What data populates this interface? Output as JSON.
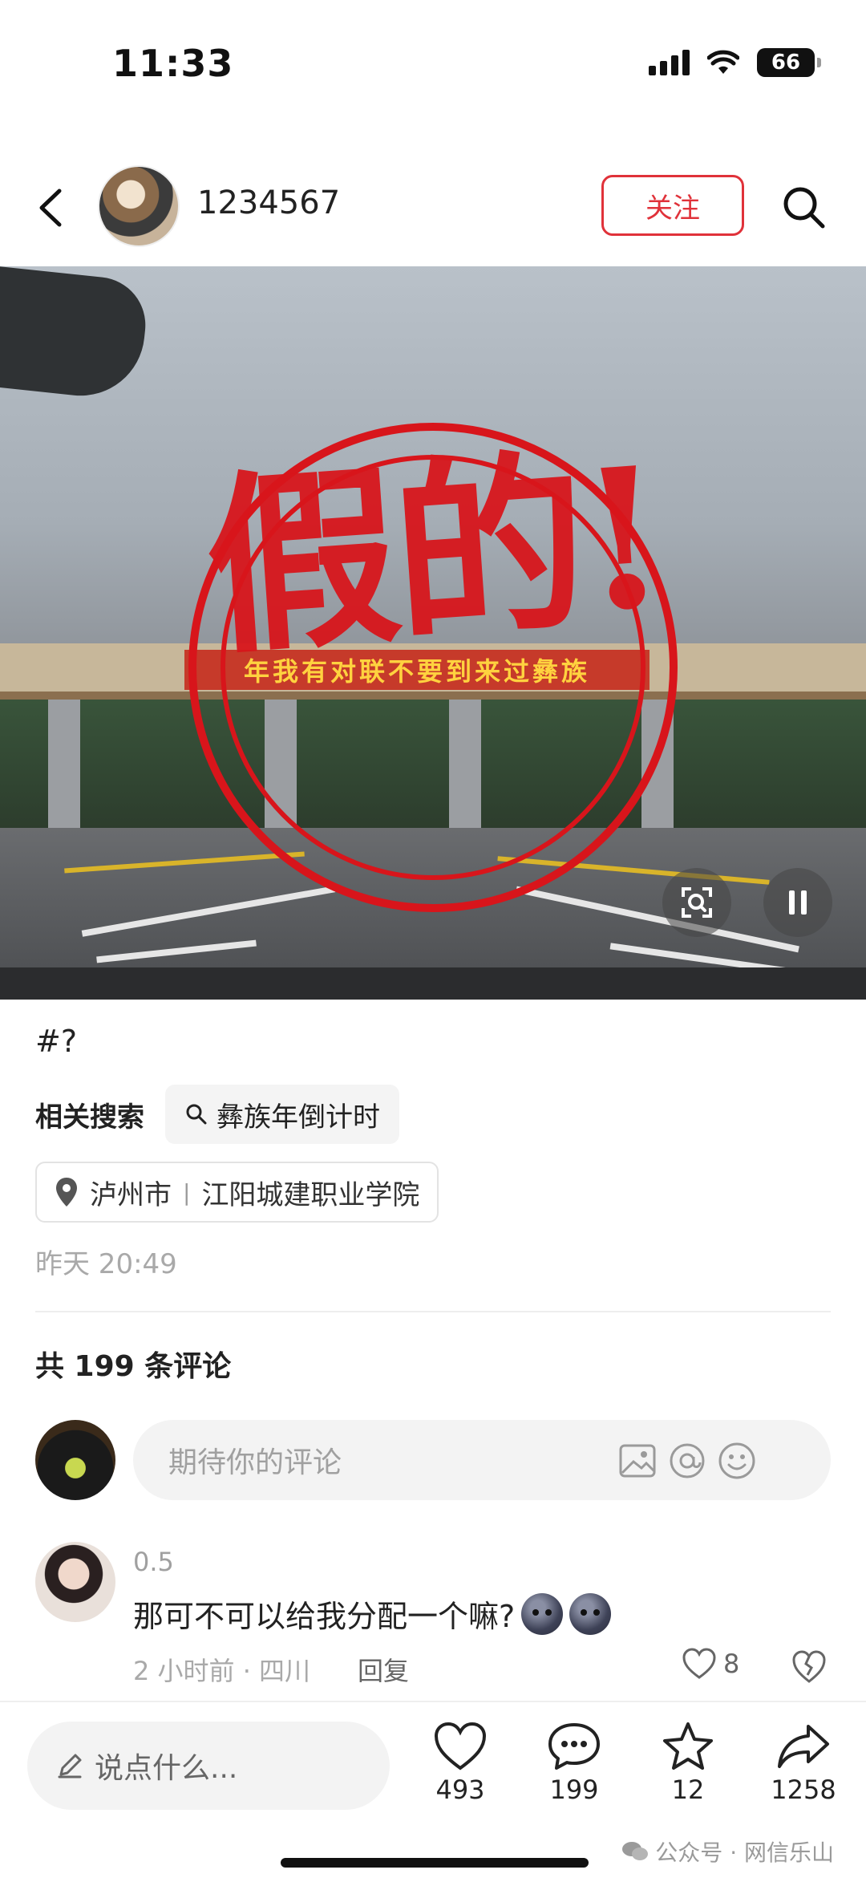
{
  "status_bar": {
    "time": "11:33",
    "battery": "66"
  },
  "header": {
    "username": "1234567",
    "follow_label": "关注"
  },
  "media": {
    "stamp_text": "假的!",
    "banner_text": "年我有对联不要到来过彝族"
  },
  "post": {
    "tag": "#?",
    "related_label": "相关搜索",
    "related_query": "彝族年倒计时",
    "location_city": "泸州市",
    "location_separator": "|",
    "location_place": "江阳城建职业学院",
    "time": "昨天 20:49"
  },
  "comments": {
    "count_text": "共 199 条评论",
    "input_placeholder": "期待你的评论",
    "items": [
      {
        "user": "0.5",
        "text": "那可不可以给我分配一个嘛?",
        "meta": "2 小时前 · 四川",
        "reply_label": "回复",
        "likes": "8"
      }
    ]
  },
  "bottom_bar": {
    "input_placeholder": "说点什么...",
    "likes": "493",
    "comments": "199",
    "favorites": "12",
    "shares": "1258"
  },
  "watermark": "公众号 · 网信乐山",
  "colors": {
    "accent": "#e0323a",
    "stamp": "#d8151b"
  }
}
